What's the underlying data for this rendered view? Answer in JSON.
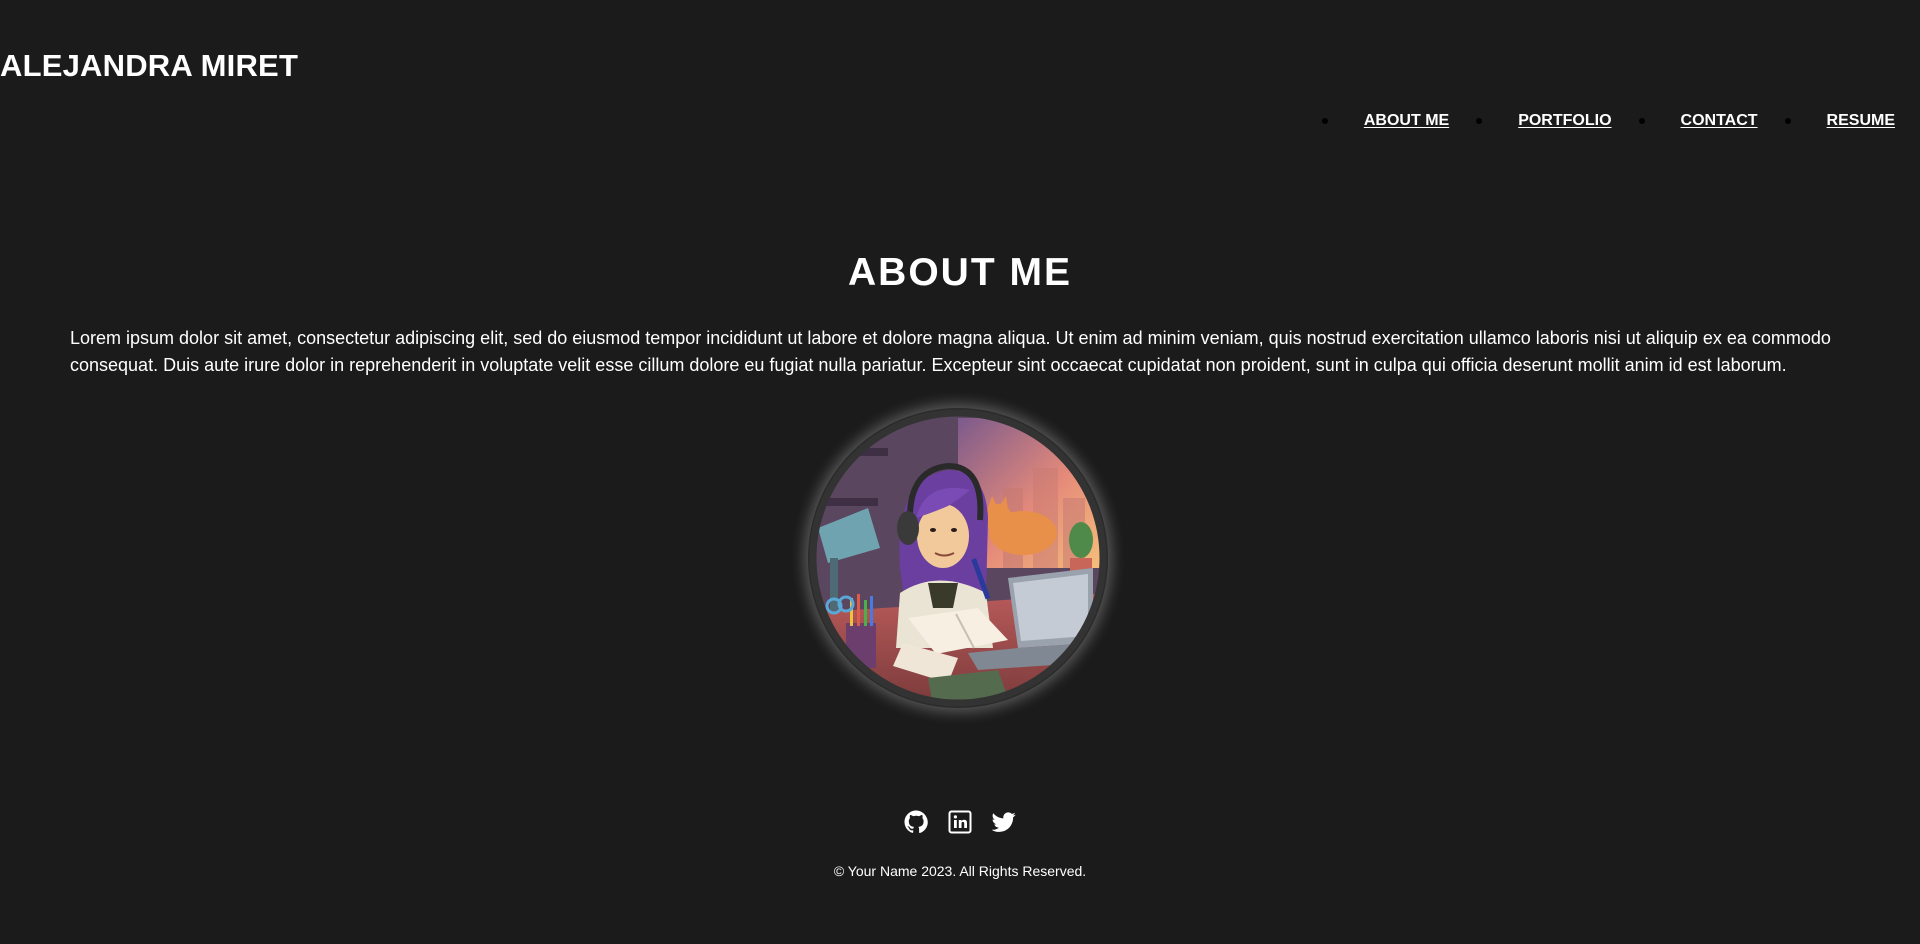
{
  "header": {
    "site_title": "ALEJANDRA MIRET"
  },
  "nav": {
    "items": [
      {
        "label": "ABOUT ME"
      },
      {
        "label": "PORTFOLIO"
      },
      {
        "label": "CONTACT"
      },
      {
        "label": "RESUME"
      }
    ]
  },
  "about": {
    "heading": "ABOUT ME",
    "body": "Lorem ipsum dolor sit amet, consectetur adipiscing elit, sed do eiusmod tempor incididunt ut labore et dolore magna aliqua. Ut enim ad minim veniam, quis nostrud exercitation ullamco laboris nisi ut aliquip ex ea commodo consequat. Duis aute irure dolor in reprehenderit in voluptate velit esse cillum dolore eu fugiat nulla pariatur. Excepteur sint occaecat cupidatat non proident, sunt in culpa qui officia deserunt mollit anim id est laborum.",
    "avatar_icon": "profile-avatar-illustration"
  },
  "footer": {
    "social": [
      {
        "icon": "github-icon"
      },
      {
        "icon": "linkedin-icon"
      },
      {
        "icon": "twitter-icon"
      }
    ],
    "copyright": "© Your Name 2023. All Rights Reserved."
  },
  "colors": {
    "background": "#1b1b1b",
    "text": "#ffffff"
  }
}
